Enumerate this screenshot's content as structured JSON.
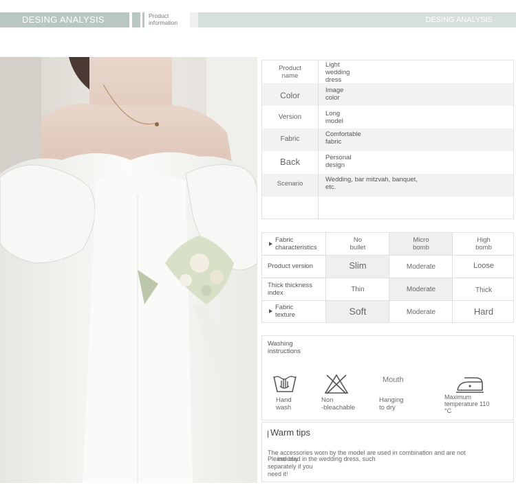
{
  "header": {
    "left_title": "DESING ANALYSIS",
    "mid_label_1": "Product",
    "mid_label_2": "information",
    "right_title": "DESING ANALYSIS"
  },
  "product_info": {
    "rows": [
      {
        "label": "Product\nname",
        "value": "Light\nwedding\ndress"
      },
      {
        "label": "Color",
        "value": "Image\ncolor"
      },
      {
        "label": "Version",
        "value": "Long\nmodel"
      },
      {
        "label": "Fabric",
        "value": "Comfortable\nfabric"
      },
      {
        "label": "Back",
        "value": "Personal\ndesign"
      },
      {
        "label": "Scenario",
        "value": "Wedding, bar mitzvah, banquet,\netc."
      },
      {
        "label": "",
        "value": ""
      }
    ]
  },
  "characteristics": {
    "rows": [
      {
        "label": "Fabric\ncharacteristics",
        "options": [
          "No\nbullet",
          "Micro\nbomb",
          "High\nbomb"
        ],
        "selected": 1
      },
      {
        "label": "Product version",
        "options": [
          "Slim",
          "Moderate",
          "Loose"
        ],
        "selected": 0
      },
      {
        "label": "Thick thickness\nindex",
        "options": [
          "Thin",
          "Moderate",
          "Thick"
        ],
        "selected": 1
      },
      {
        "label": "Fabric\ntexture",
        "options": [
          "Soft",
          "Moderate",
          "Hard"
        ],
        "selected": 0
      }
    ]
  },
  "washing": {
    "title": "Washing\ninstructions",
    "items": [
      {
        "icon": "hand-wash-icon",
        "caption": "Hand\nwash"
      },
      {
        "icon": "no-bleach-icon",
        "caption": "Non\n-bleachable"
      },
      {
        "icon": "hanging-dry-icon",
        "icon_text": "Mouth",
        "caption": "Hanging\nto dry"
      },
      {
        "icon": "iron-icon",
        "caption": "Maximum\ntemperature 110\n°C"
      }
    ]
  },
  "tips": {
    "title": "Warm tips",
    "line1": "The accessories worn by the model are used in combination and are not",
    "line2a": "included in the wedding dress, such",
    "line2b": "Please buy",
    "line2c": "separately if you\nneed it!"
  },
  "colors": {
    "header_accent": "#b8c7bf",
    "header_light": "#d6e0da",
    "row_alt": "#f2f2f2",
    "border": "#e2e2e2"
  }
}
